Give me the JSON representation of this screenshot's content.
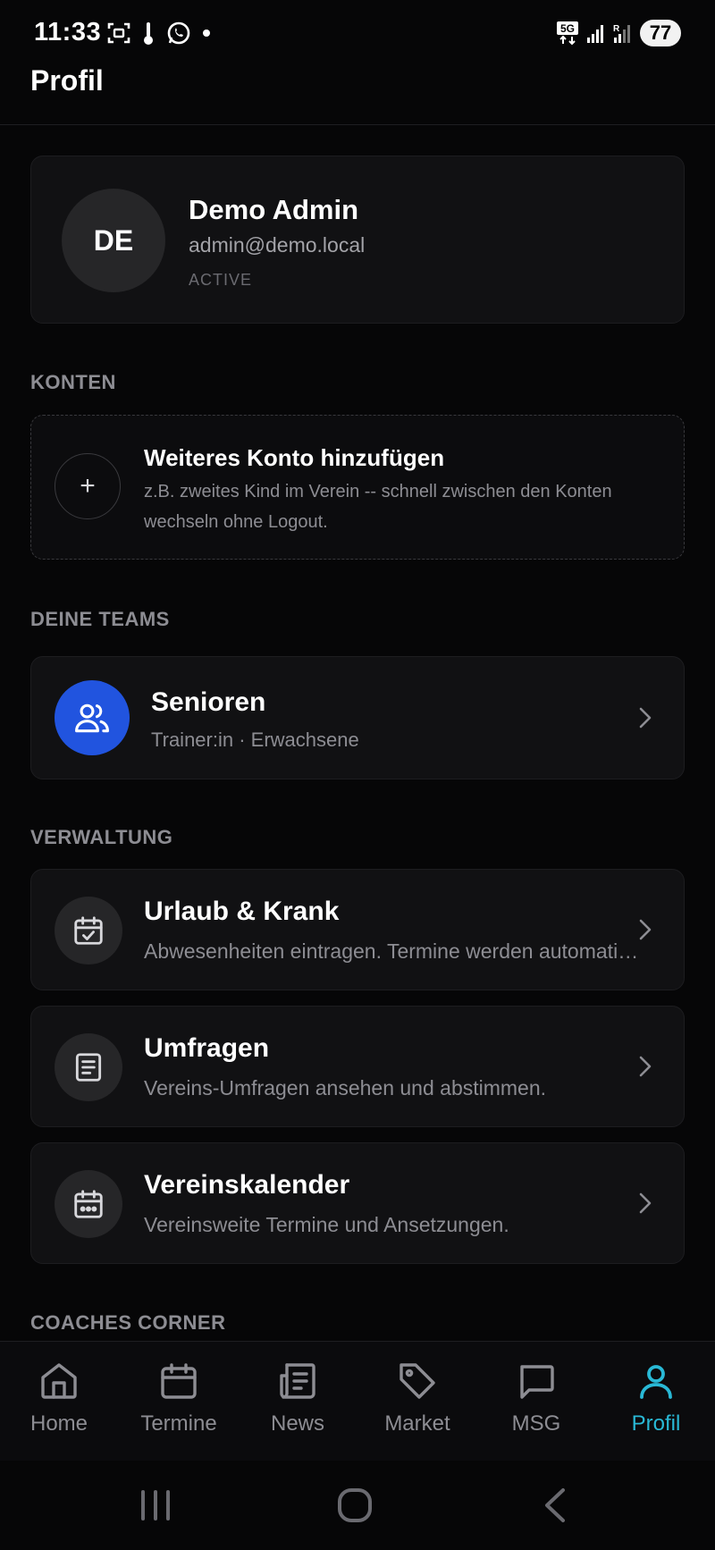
{
  "status_bar": {
    "time": "11:33",
    "network": "5G",
    "battery": "77"
  },
  "header": {
    "title": "Profil"
  },
  "profile": {
    "initials": "DE",
    "name": "Demo Admin",
    "email": "admin@demo.local",
    "status": "ACTIVE"
  },
  "accounts": {
    "section_label": "KONTEN",
    "add_title": "Weiteres Konto hinzufügen",
    "add_description": "z.B. zweites Kind im Verein -- schnell zwischen den Konten wechseln ohne Logout.",
    "add_symbol": "+"
  },
  "teams": {
    "section_label": "DEINE TEAMS",
    "items": [
      {
        "name": "Senioren",
        "subtitle": "Trainer:in · Erwachsene",
        "icon": "users-icon",
        "color": "#2154df"
      }
    ]
  },
  "admin": {
    "section_label": "VERWALTUNG",
    "items": [
      {
        "title": "Urlaub & Krank",
        "description": "Abwesenheiten eintragen. Termine werden automatisch abgesagt.",
        "icon": "calendar-check-icon"
      },
      {
        "title": "Umfragen",
        "description": "Vereins-Umfragen ansehen und abstimmen.",
        "icon": "survey-icon"
      },
      {
        "title": "Vereinskalender",
        "description": "Vereinsweite Termine und Ansetzungen.",
        "icon": "calendar-icon"
      }
    ]
  },
  "coaches": {
    "section_label": "COACHES CORNER"
  },
  "bottom_nav": {
    "items": [
      {
        "label": "Home",
        "icon": "home-icon"
      },
      {
        "label": "Termine",
        "icon": "calendar-icon"
      },
      {
        "label": "News",
        "icon": "newspaper-icon"
      },
      {
        "label": "Market",
        "icon": "tag-icon"
      },
      {
        "label": "MSG",
        "icon": "message-icon"
      },
      {
        "label": "Profil",
        "icon": "user-icon",
        "active": true
      }
    ],
    "active_color": "#29b9d6"
  }
}
